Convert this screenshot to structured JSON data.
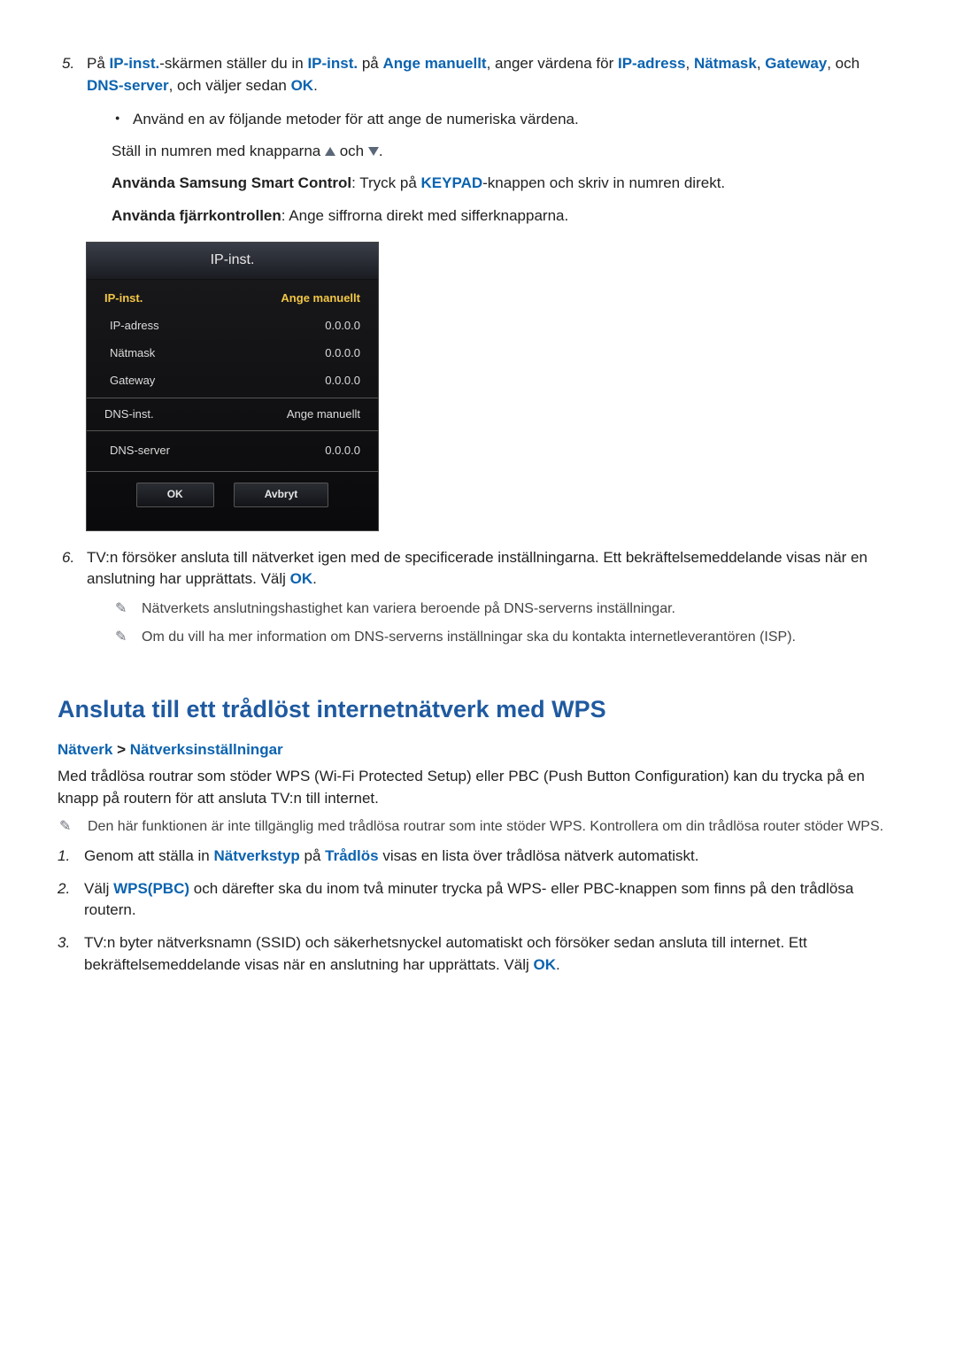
{
  "step5": {
    "num": "5.",
    "p1_a": "På ",
    "p1_b": "IP-inst.",
    "p1_c": "-skärmen ställer du in ",
    "p1_d": "IP-inst.",
    "p1_e": " på ",
    "p1_f": "Ange manuellt",
    "p1_g": ", anger värdena för ",
    "p1_h": "IP-adress",
    "p1_i": ", ",
    "p1_j": "Nätmask",
    "p1_k": ", ",
    "p1_l": "Gateway",
    "p1_m": ", och ",
    "p1_n": "DNS-server",
    "p1_o": ", och väljer sedan ",
    "p1_p": "OK",
    "p1_q": ".",
    "bullet": "Använd en av följande metoder för att ange de numeriska värdena.",
    "line_a": "Ställ in numren med knapparna ",
    "line_b": " och ",
    "line_c": ".",
    "line2_a": "Använda Samsung Smart Control",
    "line2_b": ": Tryck på ",
    "line2_c": "KEYPAD",
    "line2_d": "-knappen och skriv in numren direkt.",
    "line3_a": "Använda fjärrkontrollen",
    "line3_b": ": Ange siffrorna direkt med sifferknapparna."
  },
  "panel": {
    "title": "IP-inst.",
    "rows": [
      {
        "label": "IP-inst.",
        "value": "Ange manuellt",
        "highlight": true
      },
      {
        "label": "IP-adress",
        "value": "0.0.0.0",
        "indent": true
      },
      {
        "label": "Nätmask",
        "value": "0.0.0.0",
        "indent": true
      },
      {
        "label": "Gateway",
        "value": "0.0.0.0",
        "indent": true
      }
    ],
    "rows2": [
      {
        "label": "DNS-inst.",
        "value": "Ange manuellt"
      },
      {
        "label": "DNS-server",
        "value": "0.0.0.0",
        "indent": true
      }
    ],
    "ok": "OK",
    "cancel": "Avbryt"
  },
  "step6": {
    "num": "6.",
    "p_a": "TV:n försöker ansluta till nätverket igen med de specificerade inställningarna. Ett bekräftelsemeddelande visas när en anslutning har upprättats. Välj ",
    "p_b": "OK",
    "p_c": ".",
    "note1": "Nätverkets anslutningshastighet kan variera beroende på DNS-serverns inställningar.",
    "note2": "Om du vill ha mer information om DNS-serverns inställningar ska du kontakta internetleverantören (ISP)."
  },
  "wps": {
    "title": "Ansluta till ett trådlöst internetnätverk med WPS",
    "bc_a": "Nätverk",
    "bc_sep": " > ",
    "bc_b": "Nätverksinställningar",
    "intro": "Med trådlösa routrar som stöder WPS (Wi-Fi Protected Setup) eller PBC (Push Button Configuration) kan du trycka på en knapp på routern för att ansluta TV:n till internet.",
    "note": "Den här funktionen är inte tillgänglig med trådlösa routrar som inte stöder WPS. Kontrollera om din trådlösa router stöder WPS.",
    "s1_num": "1.",
    "s1_a": "Genom att ställa in ",
    "s1_b": "Nätverkstyp",
    "s1_c": " på ",
    "s1_d": "Trådlös",
    "s1_e": " visas en lista över trådlösa nätverk automatiskt.",
    "s2_num": "2.",
    "s2_a": "Välj ",
    "s2_b": "WPS(PBC)",
    "s2_c": " och därefter ska du inom två minuter trycka på WPS- eller PBC-knappen som finns på den trådlösa routern.",
    "s3_num": "3.",
    "s3_a": "TV:n byter nätverksnamn (SSID) och säkerhetsnyckel automatiskt och försöker sedan ansluta till internet. Ett bekräftelsemeddelande visas när en anslutning har upprättats. Välj ",
    "s3_b": "OK",
    "s3_c": "."
  },
  "icons": {
    "pencil": "✎"
  }
}
